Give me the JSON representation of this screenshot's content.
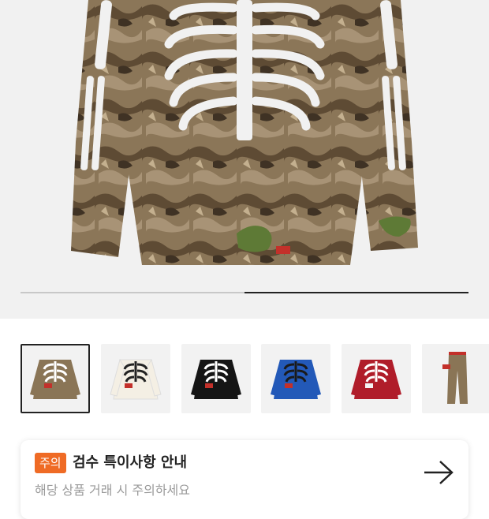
{
  "gallery": {
    "main_image_alt": "camo skeleton long sleeve top",
    "slide_progress": 0.5,
    "thumbnails": [
      {
        "name": "thumb-camo",
        "color": "#8a7556",
        "accent": "#ffffff",
        "selected": true
      },
      {
        "name": "thumb-white",
        "color": "#f4efe4",
        "accent": "#222222",
        "selected": false
      },
      {
        "name": "thumb-black",
        "color": "#151515",
        "accent": "#ffffff",
        "selected": false
      },
      {
        "name": "thumb-blue",
        "color": "#2359b8",
        "accent": "#1a1a1a",
        "selected": false
      },
      {
        "name": "thumb-red",
        "color": "#b01d2a",
        "accent": "#ffffff",
        "selected": false
      },
      {
        "name": "thumb-camo-pants",
        "color": "#8a7556",
        "accent": "#ffffff",
        "selected": false
      }
    ]
  },
  "notice": {
    "badge": "주의",
    "title": "검수 특이사항 안내",
    "subtitle": "해당 상품 거래 시 주의하세요",
    "accent_color": "#ef6b25"
  }
}
